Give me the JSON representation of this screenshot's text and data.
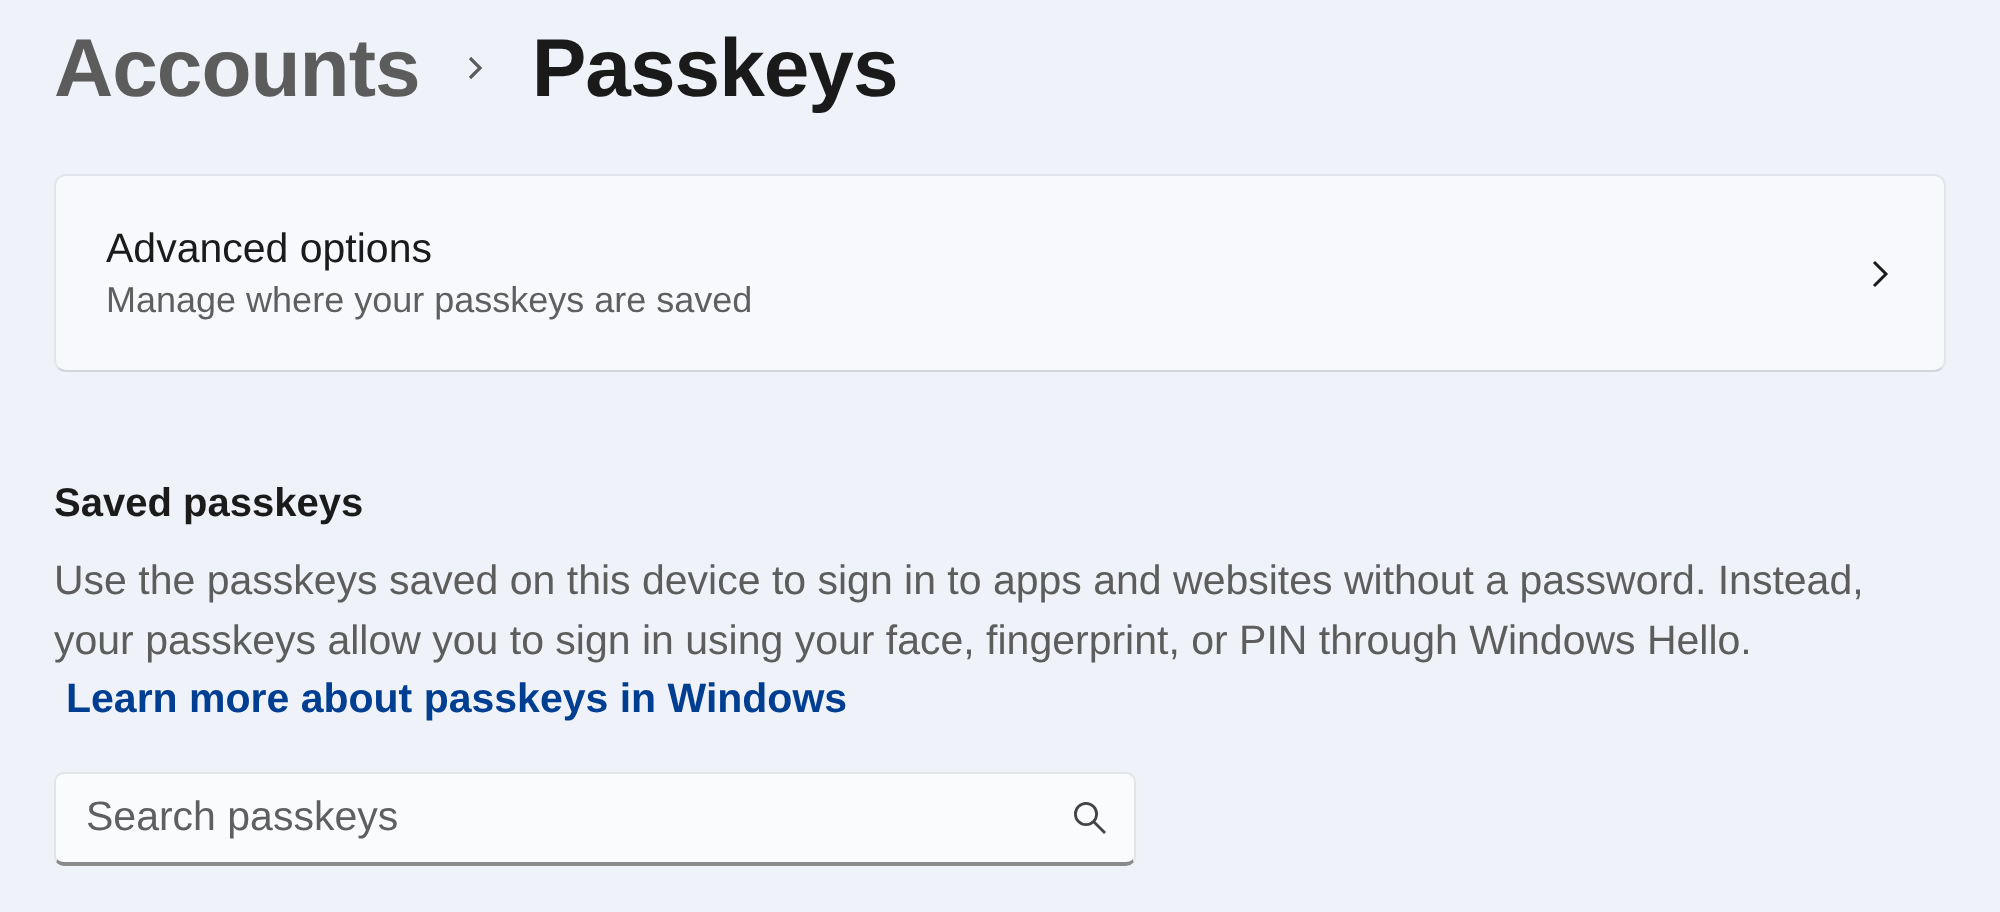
{
  "breadcrumb": {
    "parent": "Accounts",
    "current": "Passkeys"
  },
  "advanced_options": {
    "title": "Advanced options",
    "subtitle": "Manage where your passkeys are saved"
  },
  "saved_passkeys": {
    "heading": "Saved passkeys",
    "description": "Use the passkeys saved on this device to sign in to apps and websites without a password. Instead, your passkeys allow you to sign in using your face, fingerprint, or PIN through Windows Hello.",
    "link": "Learn more about passkeys in Windows"
  },
  "search": {
    "placeholder": "Search passkeys"
  }
}
